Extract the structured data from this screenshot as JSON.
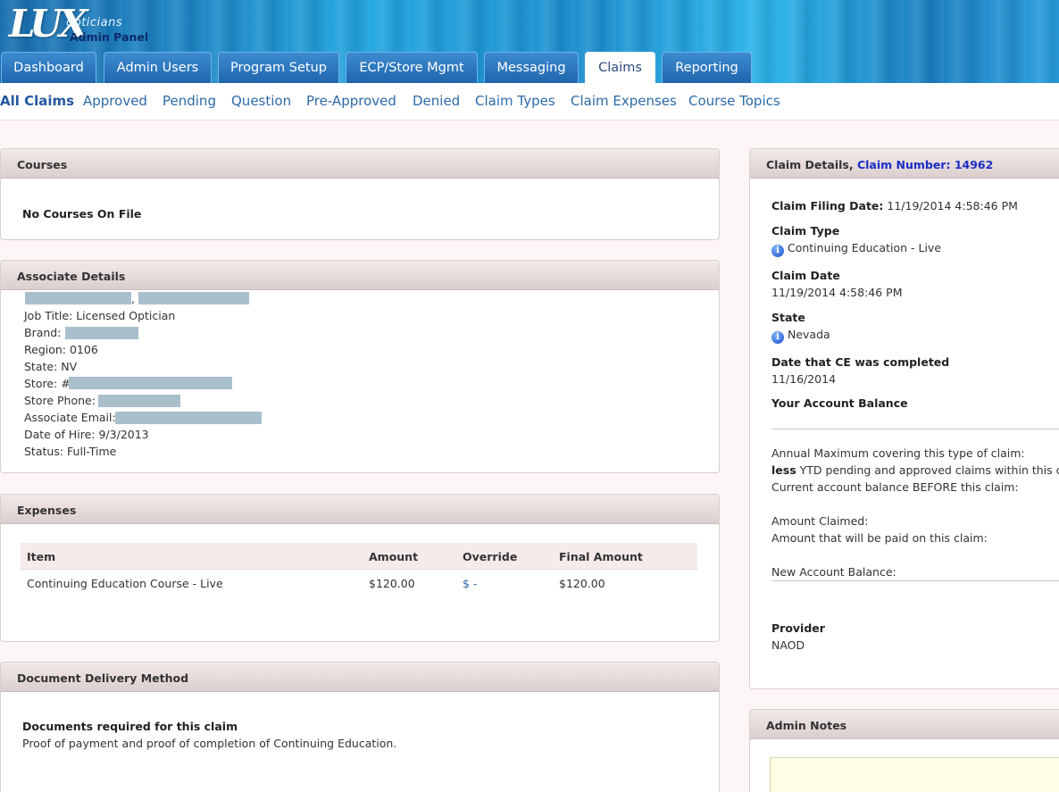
{
  "logo": {
    "main": "LUX",
    "sub": "opticians",
    "panel": "Admin Panel"
  },
  "tabs": [
    "Dashboard",
    "Admin Users",
    "Program Setup",
    "ECP/Store Mgmt",
    "Messaging",
    "Claims",
    "Reporting"
  ],
  "subnav": [
    "All Claims",
    "Approved",
    "Pending",
    "Question",
    "Pre-Approved",
    "Denied",
    "Claim Types",
    "Claim Expenses",
    "Course Topics"
  ],
  "courses": {
    "title": "Courses",
    "empty": "No Courses On File"
  },
  "associate": {
    "title": "Associate Details",
    "name_separator": ",",
    "job_title": "Job Title: Licensed Optician",
    "brand_label": "Brand:",
    "region": "Region: 0106",
    "state": "State: NV",
    "store_label": "Store: #",
    "store_phone_label": "Store Phone:",
    "email_label": "Associate Email:",
    "hire_date": "Date of Hire: 9/3/2013",
    "status": "Status: Full-Time"
  },
  "expenses": {
    "title": "Expenses",
    "headers": {
      "item": "Item",
      "amount": "Amount",
      "override": "Override",
      "final": "Final Amount"
    },
    "rows": [
      {
        "item": "Continuing Education Course - Live",
        "amount": "$120.00",
        "override": "$ -",
        "final": "$120.00"
      }
    ]
  },
  "delivery": {
    "title": "Document Delivery Method",
    "required_label": "Documents required for this claim",
    "required_text": "Proof of payment and proof of completion of Continuing Education."
  },
  "claim": {
    "title": "Claim Details,",
    "number": "Claim Number: 14962",
    "filing_date_label": "Claim Filing Date:",
    "filing_date": "11/19/2014 4:58:46 PM",
    "type_label": "Claim Type",
    "type": "Continuing Education - Live",
    "date_label": "Claim Date",
    "date": "11/19/2014 4:58:46 PM",
    "state_label": "State",
    "state": "Nevada",
    "ce_label": "Date that CE was completed",
    "ce_date": "11/16/2014",
    "balance_label": "Your Account Balance",
    "annual_max": "Annual Maximum covering this type of claim:",
    "less_word": "less",
    "less_rest": "YTD pending and approved claims within this ca",
    "current_balance": "Current account balance BEFORE this claim:",
    "amount_claimed": "Amount Claimed:",
    "amount_paid": "Amount that will be paid on this claim:",
    "new_balance": "New Account Balance:",
    "provider_label": "Provider",
    "provider": "NAOD"
  },
  "admin_notes": {
    "title": "Admin Notes"
  },
  "icons": {
    "info": "info-icon"
  }
}
